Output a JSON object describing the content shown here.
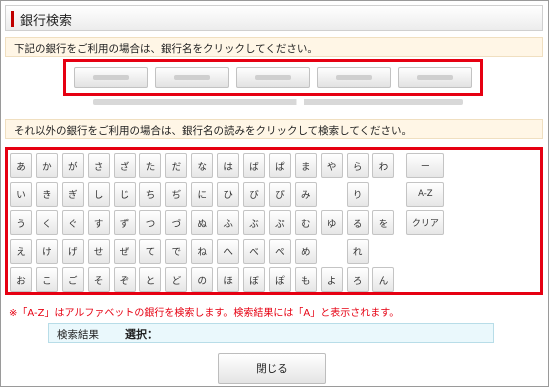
{
  "title": "銀行検索",
  "notice_banks": "下記の銀行をご利用の場合は、銀行名をクリックしてください。",
  "bank_buttons_count_note": "",
  "notice_kana": "それ以外の銀行をご利用の場合は、銀行名の読みをクリックして検索してください。",
  "kana_rows": [
    [
      "あ",
      "か",
      "が",
      "さ",
      "ざ",
      "た",
      "だ",
      "な",
      "は",
      "ば",
      "ぱ",
      "ま",
      "や",
      "ら",
      "わ",
      "ー"
    ],
    [
      "い",
      "き",
      "ぎ",
      "し",
      "じ",
      "ち",
      "ぢ",
      "に",
      "ひ",
      "び",
      "ぴ",
      "み",
      "",
      "り",
      "",
      "A-Z"
    ],
    [
      "う",
      "く",
      "ぐ",
      "す",
      "ず",
      "つ",
      "づ",
      "ぬ",
      "ふ",
      "ぶ",
      "ぷ",
      "む",
      "ゆ",
      "る",
      "を",
      "クリア"
    ],
    [
      "え",
      "け",
      "げ",
      "せ",
      "ぜ",
      "て",
      "で",
      "ね",
      "へ",
      "べ",
      "ぺ",
      "め",
      "",
      "れ",
      "",
      ""
    ],
    [
      "お",
      "こ",
      "ご",
      "そ",
      "ぞ",
      "と",
      "ど",
      "の",
      "ほ",
      "ぼ",
      "ぽ",
      "も",
      "よ",
      "ろ",
      "ん",
      ""
    ]
  ],
  "note": "※「A-Z」はアルファベットの銀行を検索します。検索結果には「A」と表示されます。",
  "result": {
    "label": "検索結果",
    "selected": "選択："
  },
  "close_label": "閉じる",
  "colors": {
    "highlight": "#e60012",
    "notice_bg": "#fff6e6",
    "result_bg": "#eaf8fc"
  }
}
